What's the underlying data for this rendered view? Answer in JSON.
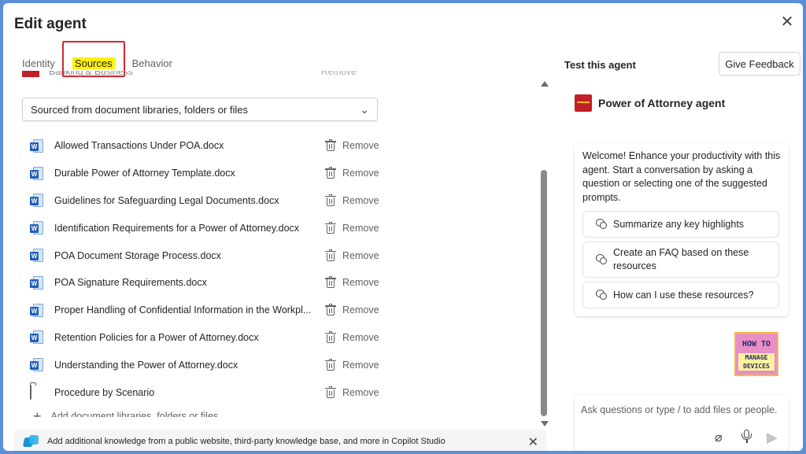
{
  "dialog": {
    "title": "Edit agent",
    "close_icon": "close-icon"
  },
  "tabs": [
    {
      "label": "Identity"
    },
    {
      "label": "Sources"
    },
    {
      "label": "Behavior"
    }
  ],
  "sources": {
    "partial_row": {
      "label": "Banking & Business",
      "remove_label": "Remove"
    },
    "dropdown_value": "Sourced from document libraries, folders or files",
    "files": [
      {
        "name": "Allowed Transactions Under POA.docx",
        "icon": "word-doc-icon",
        "remove_label": "Remove"
      },
      {
        "name": "Durable Power of Attorney Template.docx",
        "icon": "word-doc-icon",
        "remove_label": "Remove"
      },
      {
        "name": "Guidelines for Safeguarding Legal Documents.docx",
        "icon": "word-doc-icon",
        "remove_label": "Remove"
      },
      {
        "name": "Identification Requirements for a Power of Attorney.docx",
        "icon": "word-doc-icon",
        "remove_label": "Remove"
      },
      {
        "name": "POA Document Storage Process.docx",
        "icon": "word-doc-icon",
        "remove_label": "Remove"
      },
      {
        "name": "POA Signature Requirements.docx",
        "icon": "word-doc-icon",
        "remove_label": "Remove"
      },
      {
        "name": "Proper Handling of Confidential Information in the Workpl...",
        "icon": "word-doc-icon",
        "remove_label": "Remove"
      },
      {
        "name": "Retention Policies for a Power of Attorney.docx",
        "icon": "word-doc-icon",
        "remove_label": "Remove"
      },
      {
        "name": "Understanding the Power of Attorney.docx",
        "icon": "word-doc-icon",
        "remove_label": "Remove"
      },
      {
        "name": "Procedure by Scenario",
        "icon": "folder-icon",
        "remove_label": "Remove"
      }
    ],
    "add_label": "Add document libraries, folders or files"
  },
  "banner": {
    "text": "Add additional knowledge from a public website, third-party knowledge base, and more in Copilot Studio"
  },
  "test_panel": {
    "label": "Test this agent",
    "feedback_label": "Give Feedback",
    "agent_name": "Power of Attorney agent",
    "welcome": "Welcome! Enhance your productivity with this agent. Start a conversation by asking a question or selecting one of the suggested prompts.",
    "prompts": [
      {
        "label": "Summarize any key highlights"
      },
      {
        "label": "Create an FAQ based on these resources"
      },
      {
        "label": "How can I use these resources?"
      }
    ],
    "input_placeholder": "Ask questions or type / to add files or people."
  },
  "watermark": {
    "line1": "HOW TO",
    "line2": "MANAGE DEVICES"
  },
  "colors": {
    "accent_highlight": "#fff200",
    "outline_red": "#d7262d",
    "word_blue": "#1f5fbf",
    "brand_red": "#c21f28"
  }
}
